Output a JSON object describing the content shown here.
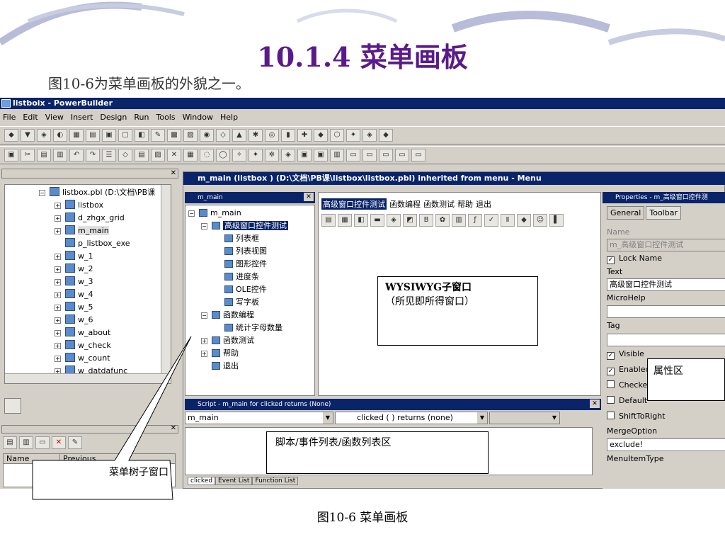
{
  "slide": {
    "title": "10.1.4 菜单画板",
    "subtitle": "图10-6为菜单画板的外貌之一。",
    "caption": "图10-6 菜单画板"
  },
  "app": {
    "title": "listboix - PowerBuilder",
    "menu": [
      "File",
      "Edit",
      "View",
      "Insert",
      "Design",
      "Run",
      "Tools",
      "Window",
      "Help"
    ]
  },
  "library": {
    "items": [
      {
        "label": "listbox.pbl (D:\\文档\\PB课",
        "expand": "−"
      },
      {
        "label": "listbox",
        "expand": "+"
      },
      {
        "label": "d_zhgx_grid",
        "expand": "+"
      },
      {
        "label": "m_main",
        "expand": "+"
      },
      {
        "label": "p_listbox_exe",
        "expand": ""
      },
      {
        "label": "w_1",
        "expand": "+"
      },
      {
        "label": "w_2",
        "expand": "+"
      },
      {
        "label": "w_3",
        "expand": "+"
      },
      {
        "label": "w_4",
        "expand": "+"
      },
      {
        "label": "w_5",
        "expand": "+"
      },
      {
        "label": "w_6",
        "expand": "+"
      },
      {
        "label": "w_about",
        "expand": "+"
      },
      {
        "label": "w_check",
        "expand": "+"
      },
      {
        "label": "w_count",
        "expand": "+"
      },
      {
        "label": "w_datdafunc",
        "expand": "+"
      }
    ],
    "col_name": "Name",
    "col_previous": "Previous"
  },
  "painter": {
    "title": "m_main (listbox ) (D:\\文档\\PB课\\listbox\\listbox.pbl) inherited from menu - Menu",
    "tree_title": "m_main",
    "tree": [
      {
        "label": "m_main",
        "level": 0,
        "expand": "−"
      },
      {
        "label": "高级窗口控件测试",
        "level": 1,
        "expand": "−",
        "selected": true
      },
      {
        "label": "列表框",
        "level": 2,
        "expand": ""
      },
      {
        "label": "列表视图",
        "level": 2,
        "expand": ""
      },
      {
        "label": "图形控件",
        "level": 2,
        "expand": ""
      },
      {
        "label": "进度条",
        "level": 2,
        "expand": ""
      },
      {
        "label": "OLE控件",
        "level": 2,
        "expand": ""
      },
      {
        "label": "写字板",
        "level": 2,
        "expand": ""
      },
      {
        "label": "函数编程",
        "level": 1,
        "expand": "−"
      },
      {
        "label": "统计字母数量",
        "level": 2,
        "expand": ""
      },
      {
        "label": "函数测试",
        "level": 1,
        "expand": "+"
      },
      {
        "label": "帮助",
        "level": 1,
        "expand": "+"
      },
      {
        "label": "退出",
        "level": 1,
        "expand": ""
      }
    ],
    "wysiwyg_menu": [
      "高级窗口控件测试",
      "函数编程",
      "函数测试",
      "帮助",
      "退出"
    ]
  },
  "script": {
    "title": "Script - m_main for clicked returns (None)",
    "object": "m_main",
    "event": "clicked ( ) returns (none)",
    "tabs": [
      "clicked",
      "Event List",
      "Function List"
    ]
  },
  "properties": {
    "title": "Properties - m_高级窗口控件测",
    "tabs": [
      "General",
      "Toolbar"
    ],
    "name_label": "Name",
    "name_value": "m_高级窗口控件测试",
    "lock_name": "Lock Name",
    "text_label": "Text",
    "text_value": "高级窗口控件测试",
    "microhelp_label": "MicroHelp",
    "tag_label": "Tag",
    "checks": [
      {
        "label": "Visible",
        "checked": true
      },
      {
        "label": "Enabled",
        "checked": true
      },
      {
        "label": "Checked",
        "checked": false
      },
      {
        "label": "Default",
        "checked": false
      },
      {
        "label": "ShiftToRight",
        "checked": false
      }
    ],
    "merge_label": "MergeOption",
    "merge_value": "exclude!",
    "menuitemtype_label": "MenuItemType"
  },
  "callouts": {
    "wysiwyg": "WYSIWYG子窗口",
    "wysiwyg_sub": "（所见即所得窗口）",
    "script": "脚本/事件列表/函数列表区",
    "tree": "菜单树子窗口",
    "props": "属性区"
  }
}
